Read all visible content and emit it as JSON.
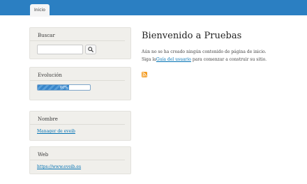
{
  "nav": {
    "tab_inicio": "Inicio"
  },
  "sidebar": {
    "search": {
      "title": "Buscar",
      "placeholder": "",
      "value": ""
    },
    "evolucion": {
      "title": "Evolución",
      "progress_percent": 60,
      "progress_label": "60%"
    },
    "nombre": {
      "title": "Nombre",
      "link": "Manager de eveib"
    },
    "web": {
      "title": "Web",
      "link": "https://www.eveib.es"
    }
  },
  "main": {
    "title": "Bienvenido a Pruebas",
    "line1": "Aún no se ha creado ningún contenido de página de inicio.",
    "line2_pre": "Siga la",
    "line2_link": "Guía del usuario",
    "line2_post": " para comenzar a construir su sitio."
  },
  "colors": {
    "topbar": "#2b7fc2",
    "link": "#0071b3",
    "rss": "#f39a1e"
  }
}
